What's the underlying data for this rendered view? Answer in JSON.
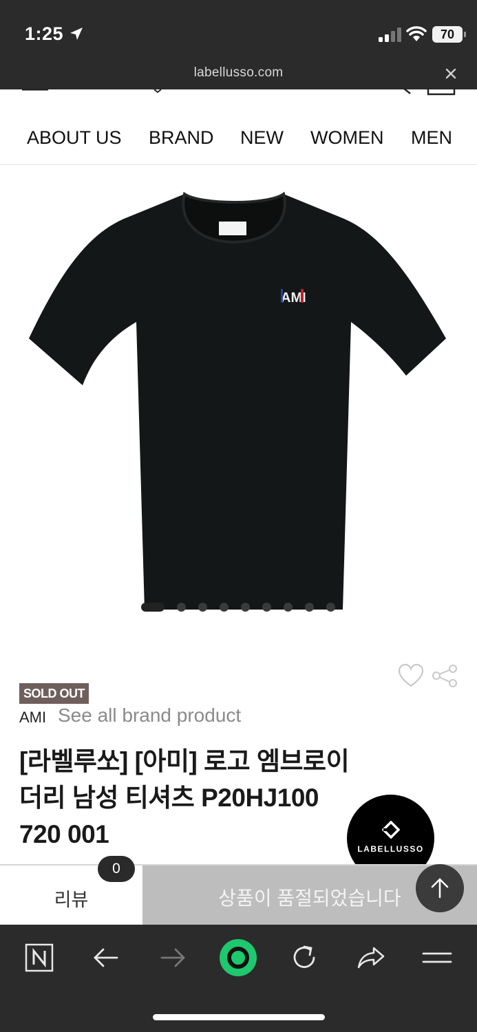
{
  "status_bar": {
    "time": "1:25",
    "battery": "70"
  },
  "browser": {
    "url": "labellusso.com"
  },
  "nav": {
    "items": [
      "ABOUT US",
      "BRAND",
      "NEW",
      "WOMEN",
      "MEN"
    ]
  },
  "product": {
    "image_label": "AMI",
    "carousel": {
      "count": 9,
      "active": 1
    },
    "badge": "SOLD OUT",
    "brand": "AMI",
    "brand_link": "See all brand product",
    "title_lines": [
      "[라벨루쏘] [아미] 로고 엠브로이",
      "더리 남성 티셔츠 P20HJ100",
      "720 001"
    ]
  },
  "floating": {
    "brand_button": "LABELLUSSO"
  },
  "bottom_bar": {
    "review_label": "리뷰",
    "review_count": "0",
    "soldout_message": "상품이 품절되었습니다"
  },
  "colors": {
    "dark_bar": "#2b2b2b",
    "soldout_badge": "#6f5f5c",
    "soldout_bar": "#bdbdbd",
    "naver_green": "#1ec86e"
  }
}
